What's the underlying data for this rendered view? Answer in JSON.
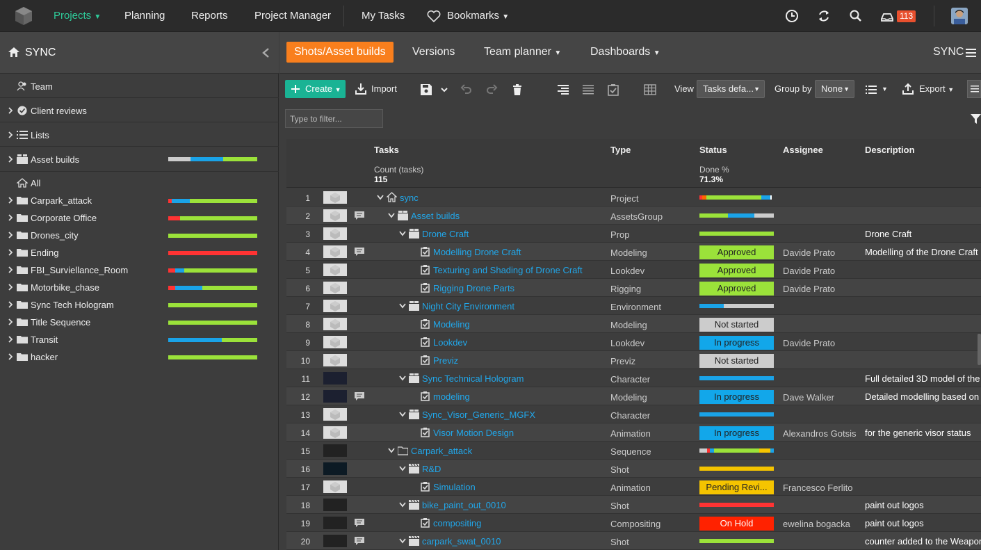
{
  "topnav": {
    "items": [
      "Projects",
      "Planning",
      "Reports",
      "Project Manager",
      "My Tasks",
      "Bookmarks"
    ],
    "notification_count": "113"
  },
  "sidebar": {
    "project_title": "SYNC",
    "team_label": "Team",
    "client_reviews_label": "Client reviews",
    "lists_label": "Lists",
    "asset_builds_label": "Asset builds",
    "all_label": "All",
    "tree": [
      {
        "label": "Carpark_attack",
        "bar": [
          [
            0.04,
            "#f33"
          ],
          [
            0.2,
            "#1aa3e8"
          ],
          [
            0.76,
            "#9be23a"
          ]
        ]
      },
      {
        "label": "Corporate Office",
        "bar": [
          [
            0.13,
            "#f33"
          ],
          [
            0.87,
            "#9be23a"
          ]
        ]
      },
      {
        "label": "Drones_city",
        "bar": [
          [
            1.0,
            "#9be23a"
          ]
        ]
      },
      {
        "label": "Ending",
        "bar": [
          [
            1.0,
            "#f33"
          ]
        ]
      },
      {
        "label": "FBI_Surviellance_Room",
        "bar": [
          [
            0.08,
            "#f33"
          ],
          [
            0.1,
            "#1aa3e8"
          ],
          [
            0.82,
            "#9be23a"
          ]
        ]
      },
      {
        "label": "Motorbike_chase",
        "bar": [
          [
            0.08,
            "#f33"
          ],
          [
            0.3,
            "#1aa3e8"
          ],
          [
            0.62,
            "#9be23a"
          ]
        ]
      },
      {
        "label": "Sync Tech Hologram",
        "bar": [
          [
            1.0,
            "#9be23a"
          ]
        ]
      },
      {
        "label": "Title Sequence",
        "bar": [
          [
            1.0,
            "#9be23a"
          ]
        ]
      },
      {
        "label": "Transit",
        "bar": [
          [
            0.6,
            "#1aa3e8"
          ],
          [
            0.4,
            "#9be23a"
          ]
        ]
      },
      {
        "label": "hacker",
        "bar": [
          [
            1.0,
            "#9be23a"
          ]
        ]
      }
    ],
    "asset_builds_bar": [
      [
        0.25,
        "#ccc"
      ],
      [
        0.37,
        "#1aa3e8"
      ],
      [
        0.38,
        "#9be23a"
      ]
    ]
  },
  "tabs": {
    "active": "Shots/Asset builds",
    "versions": "Versions",
    "team_planner": "Team planner",
    "dashboards": "Dashboards",
    "project_menu": "SYNC"
  },
  "toolbar": {
    "create": "Create",
    "import": "Import",
    "view_label": "View",
    "view_value": "Tasks defa...",
    "group_by_label": "Group by",
    "group_by_value": "None",
    "export": "Export"
  },
  "filter": {
    "placeholder": "Type to filter..."
  },
  "grid": {
    "columns": {
      "tasks": "Tasks",
      "type": "Type",
      "status": "Status",
      "assignee": "Assignee",
      "description": "Description"
    },
    "summary": {
      "count_label": "Count (tasks)",
      "count_value": "115",
      "done_label": "Done %",
      "done_value": "71.3%"
    },
    "rows": [
      {
        "n": "1",
        "name": "sync",
        "type": "Project",
        "indent": 0,
        "icon": "home",
        "chev": true,
        "thumb": "light",
        "bar": [
          [
            0.04,
            "#f33"
          ],
          [
            0.05,
            "#f60"
          ],
          [
            0.74,
            "#9be23a"
          ],
          [
            0.12,
            "#1aa3e8"
          ],
          [
            0.02,
            "#fff"
          ]
        ]
      },
      {
        "n": "2",
        "name": "Asset builds",
        "type": "AssetsGroup",
        "indent": 1,
        "icon": "box",
        "chev": true,
        "thumb": "light",
        "cmt": true,
        "bar": [
          [
            0.38,
            "#9be23a"
          ],
          [
            0.36,
            "#1aa3e8"
          ],
          [
            0.26,
            "#ccc"
          ]
        ]
      },
      {
        "n": "3",
        "name": "Drone Craft",
        "type": "Prop",
        "indent": 2,
        "icon": "box",
        "chev": true,
        "thumb": "light",
        "bar": [
          [
            1.0,
            "#9be23a"
          ]
        ],
        "desc": "Drone Craft"
      },
      {
        "n": "4",
        "name": "Modelling Drone Craft",
        "type": "Modeling",
        "indent": 3,
        "icon": "task",
        "thumb": "light",
        "cmt": true,
        "status": "Approved",
        "scolor": "#9be23a",
        "assignee": "Davide Prato",
        "desc": "Modelling of the Drone Craft"
      },
      {
        "n": "5",
        "name": "Texturing and Shading of Drone Craft",
        "type": "Lookdev",
        "indent": 3,
        "icon": "task",
        "thumb": "light",
        "status": "Approved",
        "scolor": "#9be23a",
        "assignee": "Davide Prato"
      },
      {
        "n": "6",
        "name": "Rigging Drone Parts",
        "type": "Rigging",
        "indent": 3,
        "icon": "task",
        "thumb": "light",
        "status": "Approved",
        "scolor": "#9be23a",
        "assignee": "Davide Prato"
      },
      {
        "n": "7",
        "name": "Night City Environment",
        "type": "Environment",
        "indent": 2,
        "icon": "box",
        "chev": true,
        "thumb": "light",
        "bar": [
          [
            0.33,
            "#1aa3e8"
          ],
          [
            0.67,
            "#ccc"
          ]
        ]
      },
      {
        "n": "8",
        "name": "Modeling",
        "type": "Modeling",
        "indent": 3,
        "icon": "task",
        "thumb": "light",
        "status": "Not started",
        "scolor": "#ccc"
      },
      {
        "n": "9",
        "name": "Lookdev",
        "type": "Lookdev",
        "indent": 3,
        "icon": "task",
        "thumb": "light",
        "status": "In progress",
        "scolor": "#12a7ea",
        "assignee": "Davide Prato"
      },
      {
        "n": "10",
        "name": "Previz",
        "type": "Previz",
        "indent": 3,
        "icon": "task",
        "thumb": "light",
        "status": "Not started",
        "scolor": "#ccc"
      },
      {
        "n": "11",
        "name": "Sync Technical Hologram",
        "type": "Character",
        "indent": 2,
        "icon": "box",
        "chev": true,
        "thumb": "dark",
        "bar": [
          [
            1.0,
            "#1aa3e8"
          ]
        ],
        "desc": "Full detailed 3D model of the"
      },
      {
        "n": "12",
        "name": "modeling",
        "type": "Modeling",
        "indent": 3,
        "icon": "task",
        "thumb": "dark",
        "cmt": true,
        "status": "In progress",
        "scolor": "#12a7ea",
        "assignee": "Dave Walker",
        "desc": "Detailed modelling based on"
      },
      {
        "n": "13",
        "name": "Sync_Visor_Generic_MGFX",
        "type": "Character",
        "indent": 2,
        "icon": "box",
        "chev": true,
        "thumb": "light",
        "bar": [
          [
            1.0,
            "#1aa3e8"
          ]
        ]
      },
      {
        "n": "14",
        "name": "Visor Motion Design",
        "type": "Animation",
        "indent": 3,
        "icon": "task",
        "thumb": "light",
        "status": "In progress",
        "scolor": "#12a7ea",
        "assignee": "Alexandros Gotsis",
        "desc": "for the generic visor status"
      },
      {
        "n": "15",
        "name": "Carpark_attack",
        "type": "Sequence",
        "indent": 1,
        "icon": "folder",
        "chev": true,
        "thumb": "dark2",
        "bar": [
          [
            0.1,
            "#ccc"
          ],
          [
            0.04,
            "#f33"
          ],
          [
            0.06,
            "#1aa3e8"
          ],
          [
            0.6,
            "#9be23a"
          ],
          [
            0.15,
            "#f5c400"
          ],
          [
            0.05,
            "#1aa3e8"
          ]
        ]
      },
      {
        "n": "16",
        "name": "R&D",
        "type": "Shot",
        "indent": 2,
        "icon": "clap",
        "chev": true,
        "thumb": "dark3",
        "bar": [
          [
            1.0,
            "#f5c400"
          ]
        ]
      },
      {
        "n": "17",
        "name": "Simulation",
        "type": "Animation",
        "indent": 3,
        "icon": "task",
        "thumb": "light",
        "status": "Pending Revi...",
        "scolor": "#f5c400",
        "assignee": "Francesco Ferlito"
      },
      {
        "n": "18",
        "name": "bike_paint_out_0010",
        "type": "Shot",
        "indent": 2,
        "icon": "clap",
        "chev": true,
        "thumb": "dark2",
        "bar": [
          [
            1.0,
            "#f33"
          ]
        ],
        "desc": "paint out logos"
      },
      {
        "n": "19",
        "name": "compositing",
        "type": "Compositing",
        "indent": 3,
        "icon": "task",
        "thumb": "dark2",
        "cmt": true,
        "status": "On Hold",
        "scolor": "#f20",
        "stext": "#fff",
        "assignee": "ewelina bogacka",
        "desc": "paint out logos"
      },
      {
        "n": "20",
        "name": "carpark_swat_0010",
        "type": "Shot",
        "indent": 2,
        "icon": "clap",
        "chev": true,
        "thumb": "dark2",
        "cmt": true,
        "bar": [
          [
            1.0,
            "#9be23a"
          ]
        ],
        "desc": "counter added to the Weapon"
      }
    ]
  }
}
